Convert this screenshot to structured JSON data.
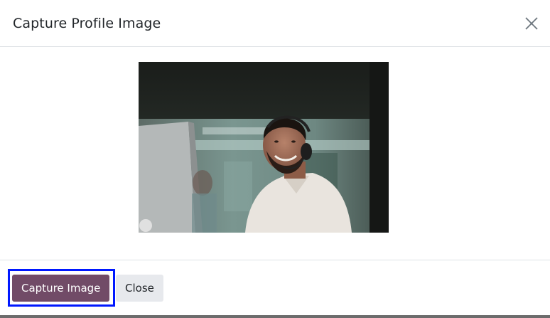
{
  "dialog": {
    "title": "Capture Profile Image",
    "close_icon": "close-x-icon"
  },
  "camera": {
    "feed": "webcam-preview"
  },
  "footer": {
    "capture_label": "Capture Image",
    "close_label": "Close"
  },
  "colors": {
    "primary": "#714b67",
    "secondary": "#e7e9ed",
    "focus": "#0018ff"
  }
}
